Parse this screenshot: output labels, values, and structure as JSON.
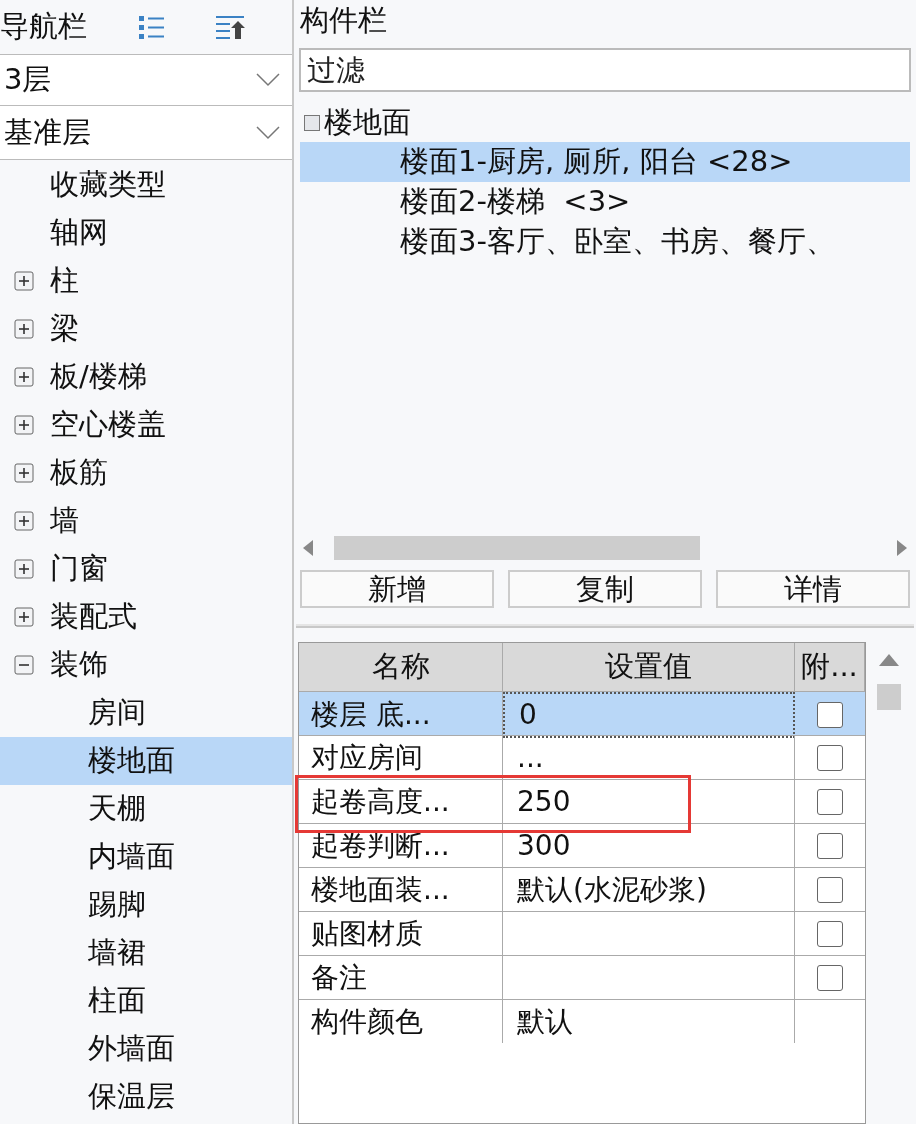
{
  "nav_panel": {
    "title": "导航栏",
    "floor_select": {
      "value": "3层"
    },
    "layer_select": {
      "value": "基准层"
    },
    "tree": [
      {
        "label": "收藏类型",
        "selected": false
      },
      {
        "label": "轴网",
        "selected": false
      },
      {
        "label": "柱",
        "selected": false,
        "expanded": false
      },
      {
        "label": "梁",
        "selected": false,
        "expanded": false
      },
      {
        "label": "板/楼梯",
        "selected": false,
        "expanded": false
      },
      {
        "label": "空心楼盖",
        "selected": false,
        "expanded": false
      },
      {
        "label": "板筋",
        "selected": false,
        "expanded": false
      },
      {
        "label": "墙",
        "selected": false,
        "expanded": false
      },
      {
        "label": "门窗",
        "selected": false,
        "expanded": false
      },
      {
        "label": "装配式",
        "selected": false,
        "expanded": false
      },
      {
        "label": "装饰",
        "selected": false,
        "expanded": true,
        "children": [
          {
            "label": "房间",
            "selected": false
          },
          {
            "label": "楼地面",
            "selected": true
          },
          {
            "label": "天棚",
            "selected": false
          },
          {
            "label": "内墙面",
            "selected": false
          },
          {
            "label": "踢脚",
            "selected": false
          },
          {
            "label": "墙裙",
            "selected": false
          },
          {
            "label": "柱面",
            "selected": false
          },
          {
            "label": "外墙面",
            "selected": false
          },
          {
            "label": "保温层",
            "selected": false
          }
        ]
      }
    ]
  },
  "component_panel": {
    "title": "构件栏",
    "filter": {
      "placeholder": "过滤"
    },
    "tree": {
      "label": "楼地面",
      "expanded": true,
      "children": [
        {
          "label": "楼面1-厨房, 厕所, 阳台 <28>",
          "selected": true
        },
        {
          "label": "楼面2-楼梯  <3>",
          "selected": false
        },
        {
          "label": "楼面3-客厅、卧室、书房、餐厅、",
          "selected": false
        }
      ]
    },
    "buttons": [
      "新增",
      "复制",
      "详情"
    ]
  },
  "property_table": {
    "columns": [
      "名称",
      "设置值",
      "附..."
    ],
    "rows": [
      {
        "name": "楼层 底...",
        "value": "0",
        "checked": false,
        "selected": true,
        "highlighted": false
      },
      {
        "name": "对应房间",
        "value": "...",
        "checked": false,
        "selected": false,
        "highlighted": false
      },
      {
        "name": "起卷高度...",
        "value": "250",
        "checked": false,
        "selected": false,
        "highlighted": true
      },
      {
        "name": "起卷判断...",
        "value": "300",
        "checked": false,
        "selected": false,
        "highlighted": false
      },
      {
        "name": "楼地面装...",
        "value": "默认(水泥砂浆)",
        "checked": false,
        "selected": false,
        "highlighted": false
      },
      {
        "name": "贴图材质",
        "checked": false,
        "selected": false,
        "highlighted": false
      },
      {
        "name": "备注",
        "checked": false,
        "selected": false,
        "highlighted": false
      },
      {
        "name": "构件颜色",
        "value": "默认",
        "selected": false,
        "highlighted": false
      }
    ]
  }
}
